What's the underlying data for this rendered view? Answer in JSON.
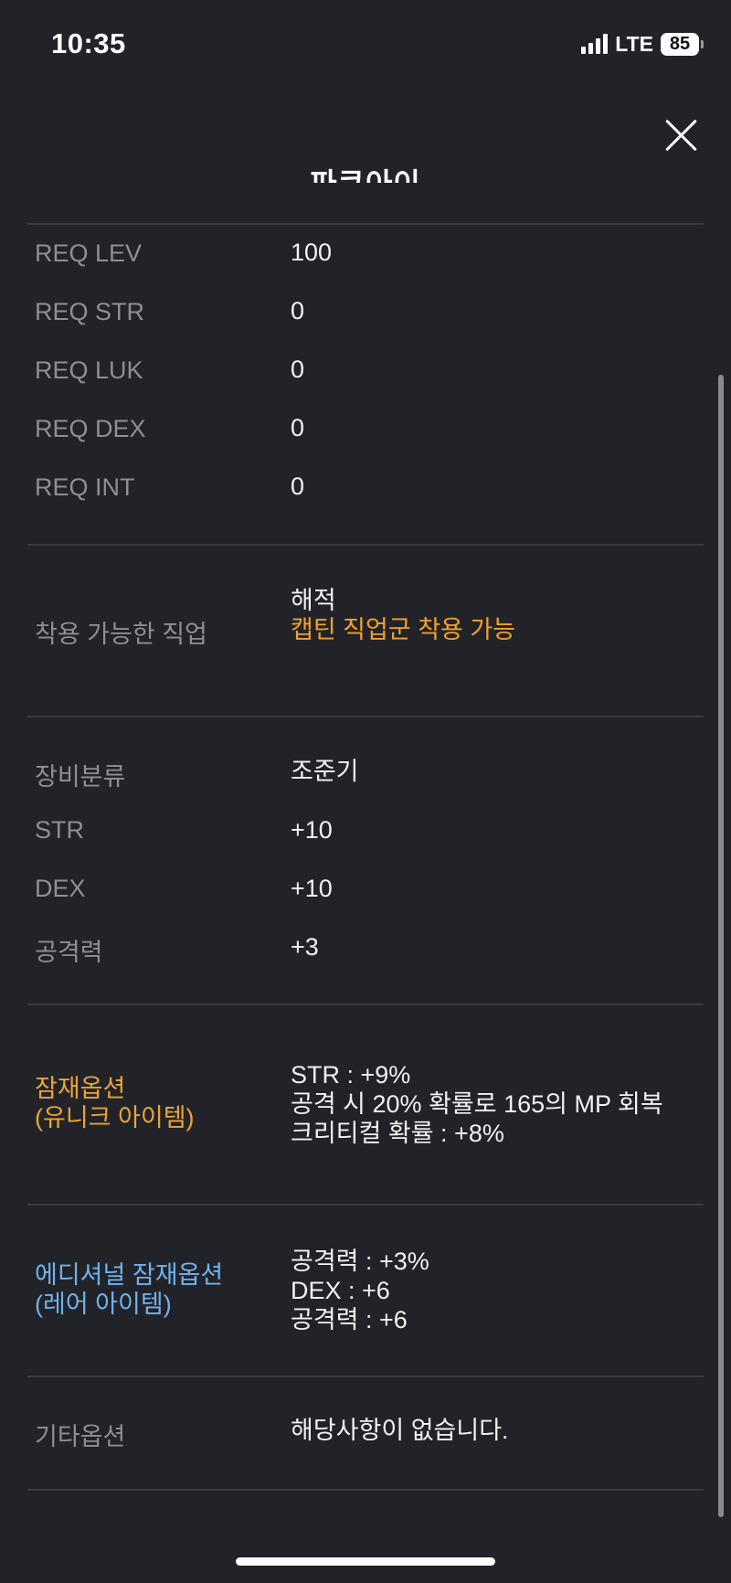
{
  "status_bar": {
    "time": "10:35",
    "network": "LTE",
    "battery": "85"
  },
  "header": {
    "title": "파쿠아이",
    "close_icon": "close-icon"
  },
  "requirements": [
    {
      "label": "REQ LEV",
      "value": "100"
    },
    {
      "label": "REQ STR",
      "value": "0"
    },
    {
      "label": "REQ LUK",
      "value": "0"
    },
    {
      "label": "REQ DEX",
      "value": "0"
    },
    {
      "label": "REQ INT",
      "value": "0"
    }
  ],
  "job": {
    "label": "착용 가능한 직업",
    "value": "해적",
    "note": "캡틴 직업군 착용 가능"
  },
  "stats": [
    {
      "label": "장비분류",
      "value": "조준기"
    },
    {
      "label": "STR",
      "value": "+10"
    },
    {
      "label": "DEX",
      "value": "+10"
    },
    {
      "label": "공격력",
      "value": "+3"
    }
  ],
  "potential": {
    "label_line1": "잠재옵션",
    "label_line2": "(유니크 아이템)",
    "lines": [
      "STR : +9%",
      "공격 시 20% 확률로 165의 MP 회복",
      "크리티컬 확률 : +8%"
    ]
  },
  "additional_potential": {
    "label_line1": "에디셔널 잠재옵션",
    "label_line2": "(레어 아이템)",
    "lines": [
      "공격력 : +3%",
      "DEX : +6",
      "공격력 : +6"
    ]
  },
  "other_options": {
    "label": "기타옵션",
    "value": "해당사항이 없습니다."
  },
  "colors": {
    "background": "#222328",
    "label": "#8e8f96",
    "unique": "#e8a43a",
    "rare": "#6fb2ec"
  }
}
